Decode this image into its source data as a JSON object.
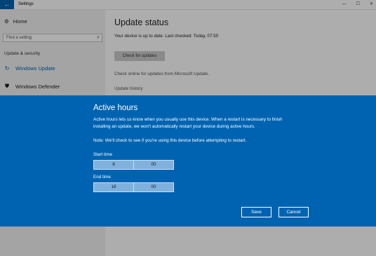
{
  "window": {
    "title": "Settings",
    "back_glyph": "←",
    "controls": [
      "—",
      "☐",
      "✕"
    ]
  },
  "sidebar": {
    "home_label": "Home",
    "search_placeholder": "Find a setting",
    "section_label": "Update & security",
    "items": [
      {
        "label": "Windows Update",
        "icon": "refresh-icon",
        "active": true
      },
      {
        "label": "Windows Defender",
        "icon": "shield-icon",
        "active": false
      }
    ]
  },
  "main": {
    "title": "Update status",
    "status_text": "Your device is up to date. Last checked: Today, 07:50",
    "check_button": "Check for updates",
    "link_online": "Check online for updates from Microsoft Update.",
    "link_history": "Update history"
  },
  "dialog": {
    "title": "Active hours",
    "description": "Active hours lets us know when you usually use this device. When a restart is necessary to finish installing an update, we won't automatically restart your device during active hours.",
    "note": "Note: We'll check to see if you're using this device before attempting to restart.",
    "start_label": "Start time",
    "start_hour": "8",
    "start_minute": "00",
    "end_label": "End time",
    "end_hour": "18",
    "end_minute": "00",
    "save_label": "Save",
    "cancel_label": "Cancel"
  },
  "colors": {
    "accent": "#0063b1"
  }
}
